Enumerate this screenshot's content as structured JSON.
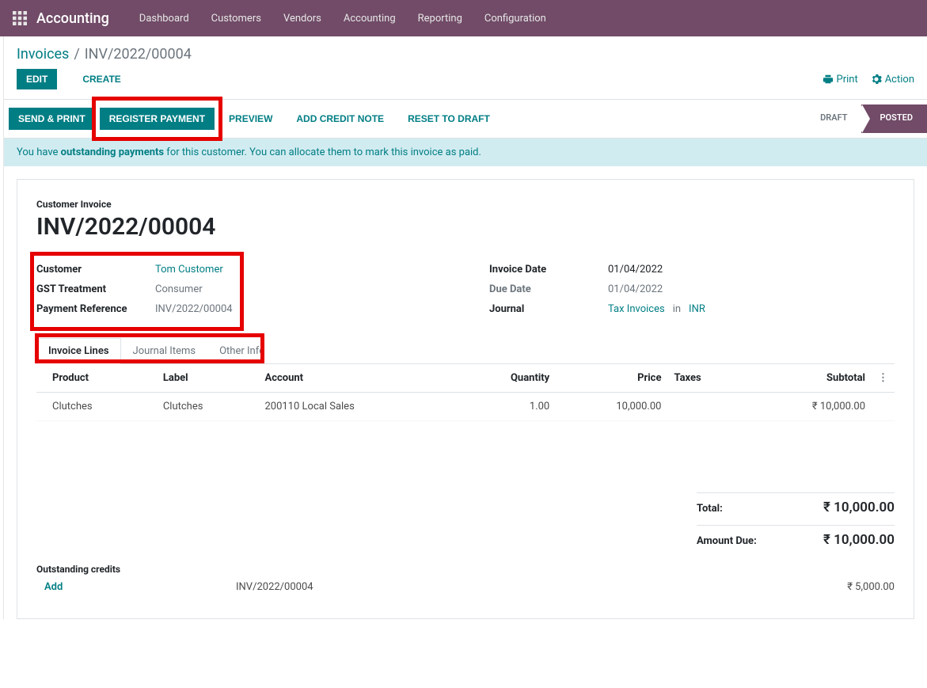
{
  "navbar": {
    "brand": "Accounting",
    "items": [
      "Dashboard",
      "Customers",
      "Vendors",
      "Accounting",
      "Reporting",
      "Configuration"
    ]
  },
  "breadcrumb": {
    "root": "Invoices",
    "leaf": "INV/2022/00004"
  },
  "toolbar": {
    "edit": "EDIT",
    "create": "CREATE",
    "print": "Print",
    "action": "Action"
  },
  "actions": {
    "send_print": "SEND & PRINT",
    "register_payment": "REGISTER PAYMENT",
    "preview": "PREVIEW",
    "add_credit_note": "ADD CREDIT NOTE",
    "reset_draft": "RESET TO DRAFT"
  },
  "status": {
    "draft": "DRAFT",
    "posted": "POSTED"
  },
  "alert": {
    "pre": "You have ",
    "bold": "outstanding payments",
    "post": " for this customer. You can allocate them to mark this invoice as paid."
  },
  "sheet": {
    "kind": "Customer Invoice",
    "name": "INV/2022/00004",
    "left": {
      "customer_label": "Customer",
      "customer": "Tom Customer",
      "gst_label": "GST Treatment",
      "gst": "Consumer",
      "payref_label": "Payment Reference",
      "payref": "INV/2022/00004"
    },
    "right": {
      "invdate_label": "Invoice Date",
      "invdate": "01/04/2022",
      "duedate_label": "Due Date",
      "duedate": "01/04/2022",
      "journal_label": "Journal",
      "journal": "Tax Invoices",
      "in": "in",
      "currency": "INR"
    }
  },
  "tabs": {
    "lines": "Invoice Lines",
    "journal": "Journal Items",
    "other": "Other Info"
  },
  "table": {
    "headers": {
      "product": "Product",
      "label": "Label",
      "account": "Account",
      "quantity": "Quantity",
      "price": "Price",
      "taxes": "Taxes",
      "subtotal": "Subtotal"
    },
    "rows": [
      {
        "product": "Clutches",
        "label": "Clutches",
        "account": "200110 Local Sales",
        "quantity": "1.00",
        "price": "10,000.00",
        "taxes": "",
        "subtotal": "₹ 10,000.00"
      }
    ]
  },
  "totals": {
    "total_label": "Total:",
    "total": "₹ 10,000.00",
    "due_label": "Amount Due:",
    "due": "₹ 10,000.00"
  },
  "outstanding": {
    "title": "Outstanding credits",
    "add": "Add",
    "ref": "INV/2022/00004",
    "amount": "₹ 5,000.00"
  }
}
